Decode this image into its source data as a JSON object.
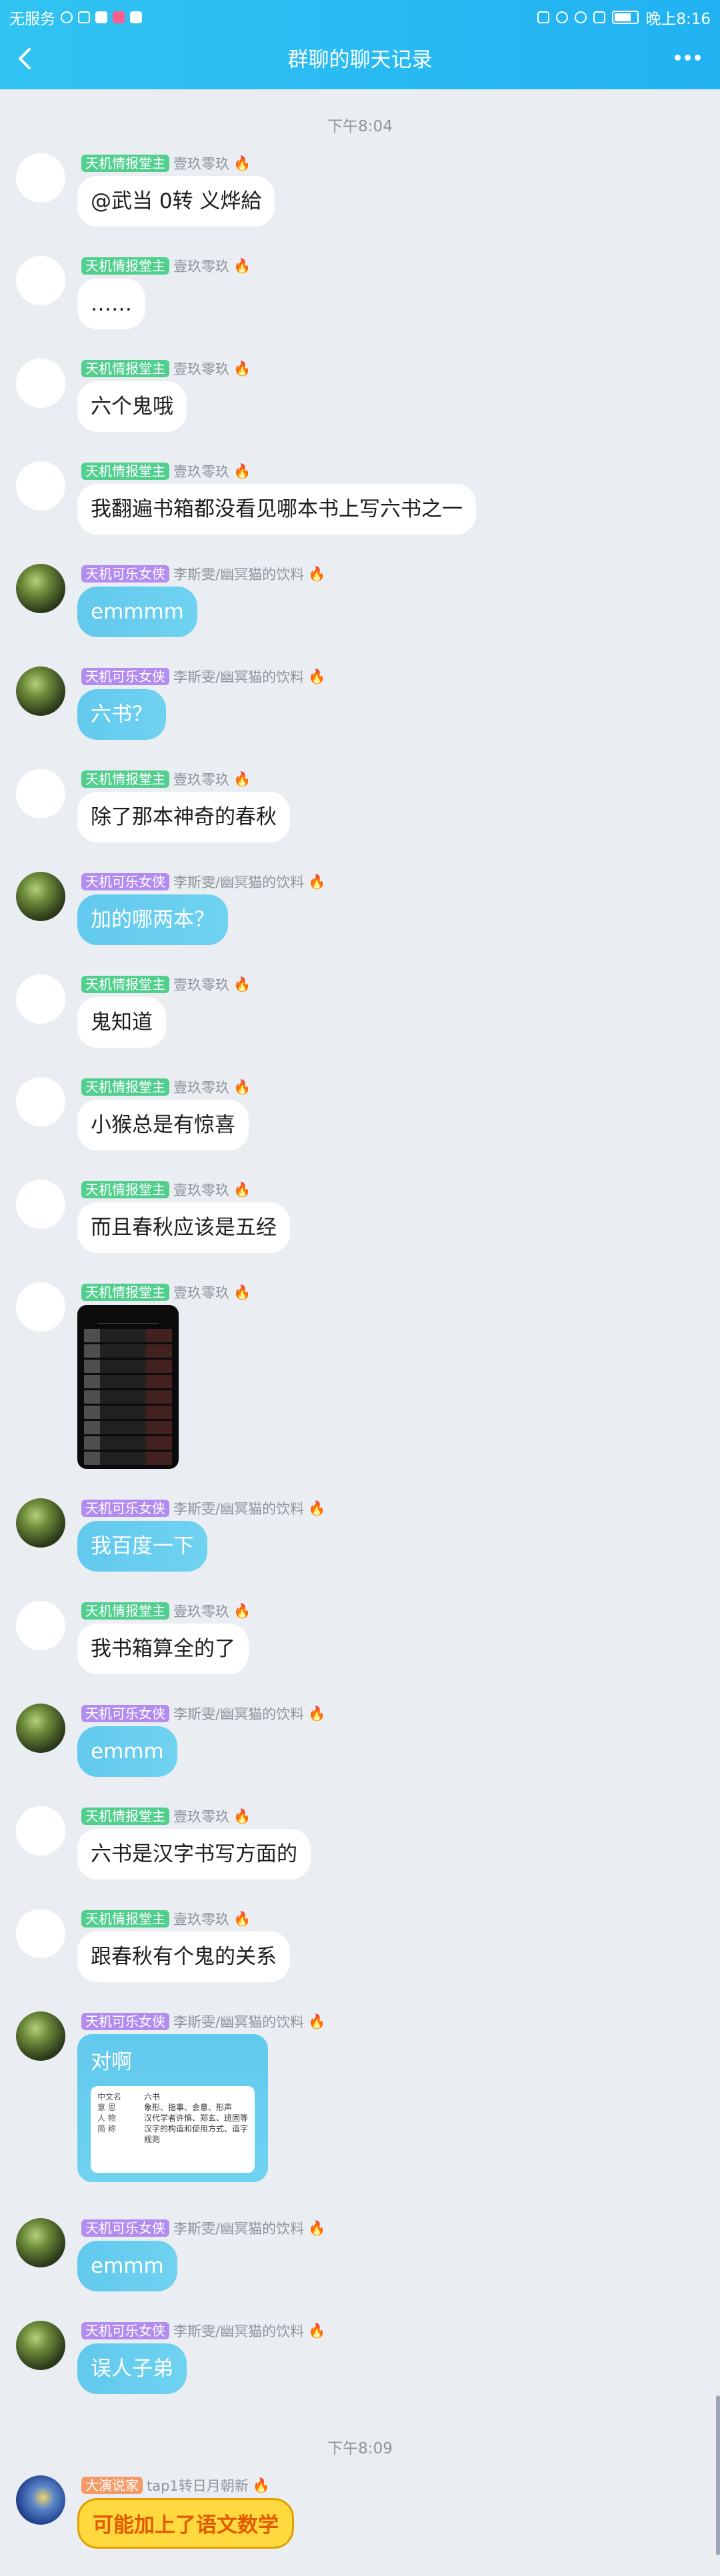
{
  "status_bar": {
    "carrier": "无服务",
    "time": "晚上8:16"
  },
  "header": {
    "title": "群聊的聊天记录",
    "back_icon": "chevron-left-icon",
    "more_icon": "more-dots-icon"
  },
  "timestamps": [
    "下午8:04",
    "下午8:09"
  ],
  "users": {
    "u1": {
      "badge": "天机情报堂主",
      "nick": "壹玖零玖"
    },
    "u2": {
      "badge": "天机可乐女侠",
      "nick": "李斯雯/幽冥猫的饮料"
    },
    "u3": {
      "badge": "大演说家",
      "nick": "tap1转日月朝新"
    }
  },
  "messages": [
    {
      "user": "u1",
      "text": "@武当 0转  义烨給"
    },
    {
      "user": "u1",
      "text": "……"
    },
    {
      "user": "u1",
      "text": "六个鬼哦"
    },
    {
      "user": "u1",
      "text": "我翻遍书箱都没看见哪本书上写六书之一"
    },
    {
      "user": "u2",
      "text": "emmmm"
    },
    {
      "user": "u2",
      "text": "六书？"
    },
    {
      "user": "u1",
      "text": "除了那本神奇的春秋"
    },
    {
      "user": "u2",
      "text": "加的哪两本？"
    },
    {
      "user": "u1",
      "text": "鬼知道"
    },
    {
      "user": "u1",
      "text": "小猴总是有惊喜"
    },
    {
      "user": "u1",
      "text": "而且春秋应该是五经"
    },
    {
      "user": "u1",
      "text": "[image]"
    },
    {
      "user": "u2",
      "text": "我百度一下"
    },
    {
      "user": "u1",
      "text": "我书箱算全的了"
    },
    {
      "user": "u2",
      "text": "emmm"
    },
    {
      "user": "u1",
      "text": "六书是汉字书写方面的"
    },
    {
      "user": "u1",
      "text": "跟春秋有个鬼的关系"
    },
    {
      "user": "u2",
      "text": "对啊",
      "card_rows": [
        {
          "k": "中文名",
          "v": "六书"
        },
        {
          "k": "意  思",
          "v": "象形、指事、会意、形声"
        },
        {
          "k": "人  物",
          "v": "汉代学者许慎、郑玄、班固等"
        },
        {
          "k": "简  称",
          "v": "汉字的构造和使用方式、造字规则"
        }
      ]
    },
    {
      "user": "u2",
      "text": "emmm"
    },
    {
      "user": "u2",
      "text": "误人子弟"
    },
    {
      "user": "u3",
      "text": "可能加上了语文数学"
    }
  ]
}
